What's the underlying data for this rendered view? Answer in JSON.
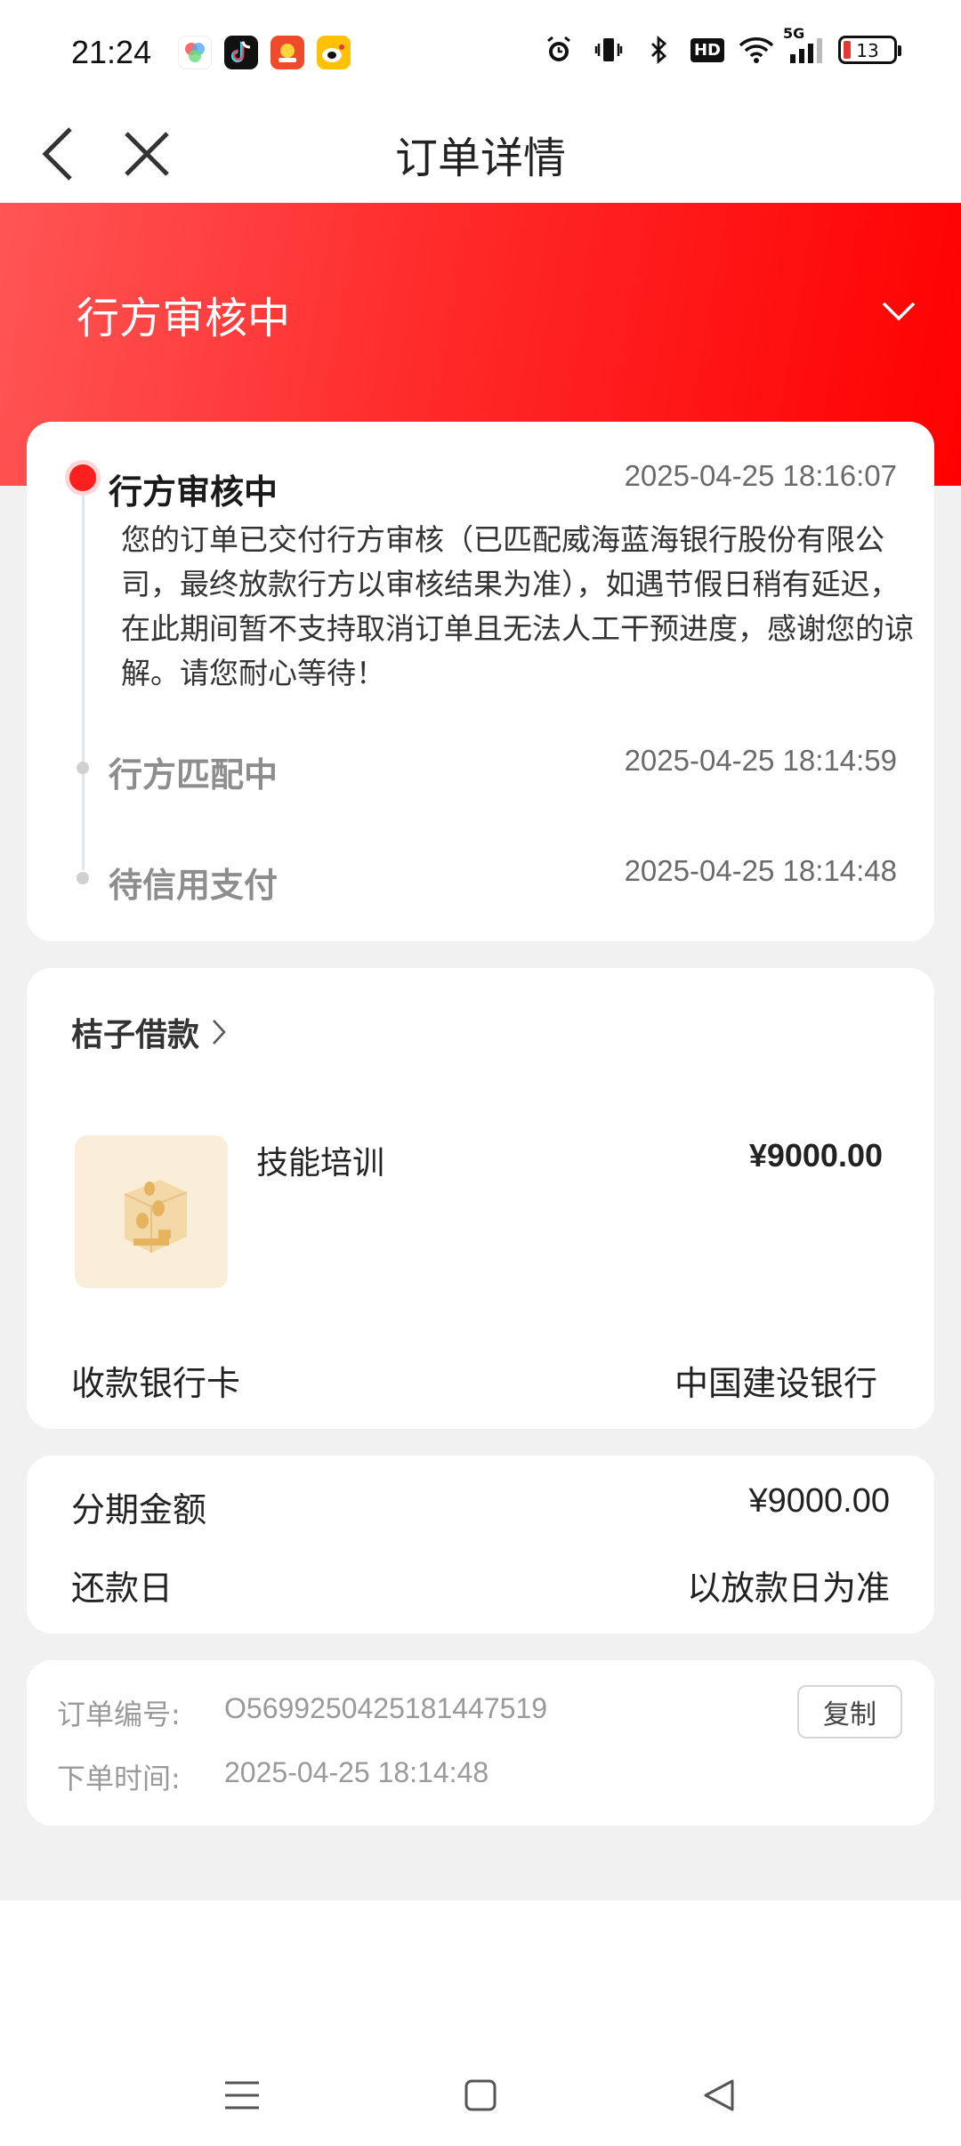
{
  "status_bar": {
    "time": "21:24",
    "network": "5G",
    "hd": "HD",
    "battery": "13",
    "apps": [
      "photos-app-icon",
      "douyin-app-icon",
      "game-app-icon",
      "weibo-app-icon"
    ]
  },
  "header": {
    "title": "订单详情"
  },
  "banner": {
    "status": "行方审核中"
  },
  "timeline": {
    "steps": [
      {
        "title": "行方审核中",
        "time": "2025-04-25 18:16:07",
        "desc": "您的订单已交付行方审核（已匹配威海蓝海银行股份有限公司，最终放款行方以审核结果为准），如遇节假日稍有延迟，在此期间暂不支持取消订单且无法人工干预进度，感谢您的谅解。请您耐心等待！",
        "active": true
      },
      {
        "title": "行方匹配中",
        "time": "2025-04-25 18:14:59",
        "active": false
      },
      {
        "title": "待信用支付",
        "time": "2025-04-25 18:14:48",
        "active": false
      }
    ]
  },
  "product": {
    "merchant": "桔子借款",
    "name": "技能培训",
    "price": "¥9000.00",
    "bank_label": "收款银行卡",
    "bank_value": "中国建设银行"
  },
  "installment": {
    "amount_label": "分期金额",
    "amount_value": "¥9000.00",
    "repay_label": "还款日",
    "repay_value": "以放款日为准"
  },
  "order_info": {
    "number_label": "订单编号:",
    "number_value": "O569925042518144751​9",
    "copy_label": "复制",
    "time_label": "下单时间:",
    "time_value": "2025-04-25 18:14:48"
  },
  "colors": {
    "brand_red": "#ff1f1f",
    "background": "#f1f1f1"
  }
}
